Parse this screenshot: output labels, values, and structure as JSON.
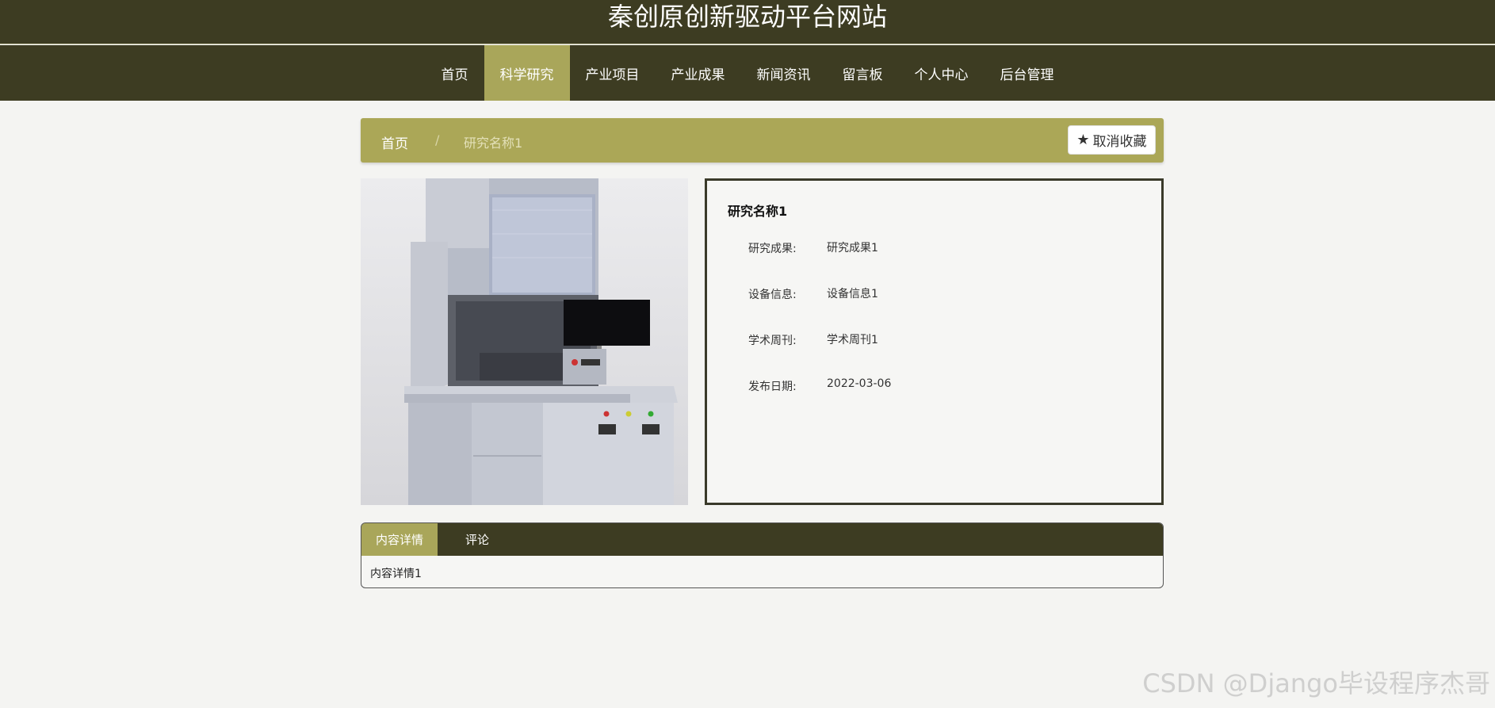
{
  "site": {
    "title": "秦创原创新驱动平台网站"
  },
  "nav": {
    "items": [
      {
        "label": "首页"
      },
      {
        "label": "科学研究"
      },
      {
        "label": "产业项目"
      },
      {
        "label": "产业成果"
      },
      {
        "label": "新闻资讯"
      },
      {
        "label": "留言板"
      },
      {
        "label": "个人中心"
      },
      {
        "label": "后台管理"
      }
    ],
    "active": "科学研究"
  },
  "breadcrumb": {
    "home": "首页",
    "separator": "/",
    "current": "研究名称1"
  },
  "favorite_button": {
    "label": "取消收藏",
    "icon": "star-icon"
  },
  "detail": {
    "title": "研究名称1",
    "fields": [
      {
        "label": "研究成果:",
        "value": "研究成果1"
      },
      {
        "label": "设备信息:",
        "value": "设备信息1"
      },
      {
        "label": "学术周刊:",
        "value": "学术周刊1"
      },
      {
        "label": "发布日期:",
        "value": "2022-03-06"
      }
    ]
  },
  "tabs": {
    "items": [
      {
        "label": "内容详情"
      },
      {
        "label": "评论"
      }
    ],
    "active": "内容详情",
    "content": "内容详情1"
  },
  "watermark": "CSDN @Django毕设程序杰哥",
  "colors": {
    "header_bg": "#3d3c22",
    "accent": "#aba757",
    "page_bg": "#f4f4f2"
  }
}
